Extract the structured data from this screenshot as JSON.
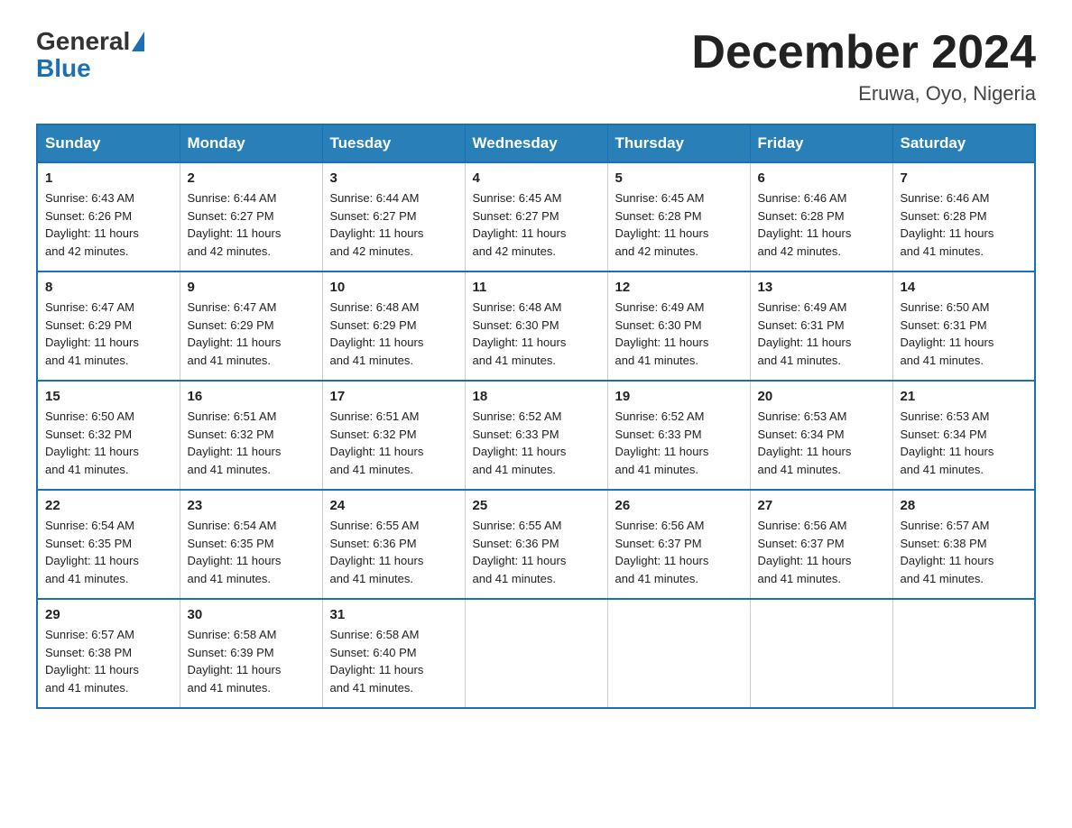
{
  "header": {
    "logo_general": "General",
    "logo_blue": "Blue",
    "month_title": "December 2024",
    "location": "Eruwa, Oyo, Nigeria"
  },
  "weekdays": [
    "Sunday",
    "Monday",
    "Tuesday",
    "Wednesday",
    "Thursday",
    "Friday",
    "Saturday"
  ],
  "weeks": [
    [
      {
        "day": "1",
        "sunrise": "6:43 AM",
        "sunset": "6:26 PM",
        "daylight": "11 hours and 42 minutes."
      },
      {
        "day": "2",
        "sunrise": "6:44 AM",
        "sunset": "6:27 PM",
        "daylight": "11 hours and 42 minutes."
      },
      {
        "day": "3",
        "sunrise": "6:44 AM",
        "sunset": "6:27 PM",
        "daylight": "11 hours and 42 minutes."
      },
      {
        "day": "4",
        "sunrise": "6:45 AM",
        "sunset": "6:27 PM",
        "daylight": "11 hours and 42 minutes."
      },
      {
        "day": "5",
        "sunrise": "6:45 AM",
        "sunset": "6:28 PM",
        "daylight": "11 hours and 42 minutes."
      },
      {
        "day": "6",
        "sunrise": "6:46 AM",
        "sunset": "6:28 PM",
        "daylight": "11 hours and 42 minutes."
      },
      {
        "day": "7",
        "sunrise": "6:46 AM",
        "sunset": "6:28 PM",
        "daylight": "11 hours and 41 minutes."
      }
    ],
    [
      {
        "day": "8",
        "sunrise": "6:47 AM",
        "sunset": "6:29 PM",
        "daylight": "11 hours and 41 minutes."
      },
      {
        "day": "9",
        "sunrise": "6:47 AM",
        "sunset": "6:29 PM",
        "daylight": "11 hours and 41 minutes."
      },
      {
        "day": "10",
        "sunrise": "6:48 AM",
        "sunset": "6:29 PM",
        "daylight": "11 hours and 41 minutes."
      },
      {
        "day": "11",
        "sunrise": "6:48 AM",
        "sunset": "6:30 PM",
        "daylight": "11 hours and 41 minutes."
      },
      {
        "day": "12",
        "sunrise": "6:49 AM",
        "sunset": "6:30 PM",
        "daylight": "11 hours and 41 minutes."
      },
      {
        "day": "13",
        "sunrise": "6:49 AM",
        "sunset": "6:31 PM",
        "daylight": "11 hours and 41 minutes."
      },
      {
        "day": "14",
        "sunrise": "6:50 AM",
        "sunset": "6:31 PM",
        "daylight": "11 hours and 41 minutes."
      }
    ],
    [
      {
        "day": "15",
        "sunrise": "6:50 AM",
        "sunset": "6:32 PM",
        "daylight": "11 hours and 41 minutes."
      },
      {
        "day": "16",
        "sunrise": "6:51 AM",
        "sunset": "6:32 PM",
        "daylight": "11 hours and 41 minutes."
      },
      {
        "day": "17",
        "sunrise": "6:51 AM",
        "sunset": "6:32 PM",
        "daylight": "11 hours and 41 minutes."
      },
      {
        "day": "18",
        "sunrise": "6:52 AM",
        "sunset": "6:33 PM",
        "daylight": "11 hours and 41 minutes."
      },
      {
        "day": "19",
        "sunrise": "6:52 AM",
        "sunset": "6:33 PM",
        "daylight": "11 hours and 41 minutes."
      },
      {
        "day": "20",
        "sunrise": "6:53 AM",
        "sunset": "6:34 PM",
        "daylight": "11 hours and 41 minutes."
      },
      {
        "day": "21",
        "sunrise": "6:53 AM",
        "sunset": "6:34 PM",
        "daylight": "11 hours and 41 minutes."
      }
    ],
    [
      {
        "day": "22",
        "sunrise": "6:54 AM",
        "sunset": "6:35 PM",
        "daylight": "11 hours and 41 minutes."
      },
      {
        "day": "23",
        "sunrise": "6:54 AM",
        "sunset": "6:35 PM",
        "daylight": "11 hours and 41 minutes."
      },
      {
        "day": "24",
        "sunrise": "6:55 AM",
        "sunset": "6:36 PM",
        "daylight": "11 hours and 41 minutes."
      },
      {
        "day": "25",
        "sunrise": "6:55 AM",
        "sunset": "6:36 PM",
        "daylight": "11 hours and 41 minutes."
      },
      {
        "day": "26",
        "sunrise": "6:56 AM",
        "sunset": "6:37 PM",
        "daylight": "11 hours and 41 minutes."
      },
      {
        "day": "27",
        "sunrise": "6:56 AM",
        "sunset": "6:37 PM",
        "daylight": "11 hours and 41 minutes."
      },
      {
        "day": "28",
        "sunrise": "6:57 AM",
        "sunset": "6:38 PM",
        "daylight": "11 hours and 41 minutes."
      }
    ],
    [
      {
        "day": "29",
        "sunrise": "6:57 AM",
        "sunset": "6:38 PM",
        "daylight": "11 hours and 41 minutes."
      },
      {
        "day": "30",
        "sunrise": "6:58 AM",
        "sunset": "6:39 PM",
        "daylight": "11 hours and 41 minutes."
      },
      {
        "day": "31",
        "sunrise": "6:58 AM",
        "sunset": "6:40 PM",
        "daylight": "11 hours and 41 minutes."
      },
      null,
      null,
      null,
      null
    ]
  ],
  "labels": {
    "sunrise": "Sunrise:",
    "sunset": "Sunset:",
    "daylight": "Daylight:"
  }
}
